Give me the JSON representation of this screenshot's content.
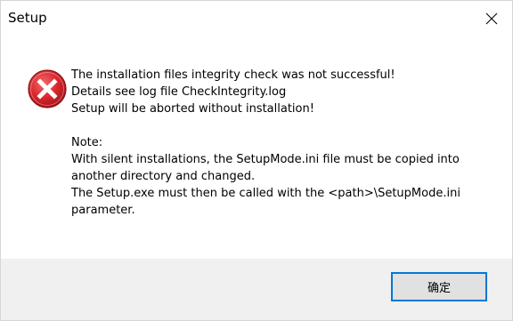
{
  "window": {
    "title": "Setup",
    "close_icon": "close-icon"
  },
  "dialog": {
    "icon": "error-icon",
    "icon_color": "#d9262c",
    "lines": [
      "The installation files integrity check was not successful!",
      "Details see log file CheckIntegrity.log",
      "Setup will be aborted without installation!",
      "",
      "Note:",
      "With silent installations, the SetupMode.ini file must be copied into",
      "another directory and changed.",
      "The Setup.exe must then be called with the <path>\\SetupMode.ini",
      "parameter."
    ]
  },
  "footer": {
    "ok_label": "确定",
    "accent": "#0078d7"
  }
}
